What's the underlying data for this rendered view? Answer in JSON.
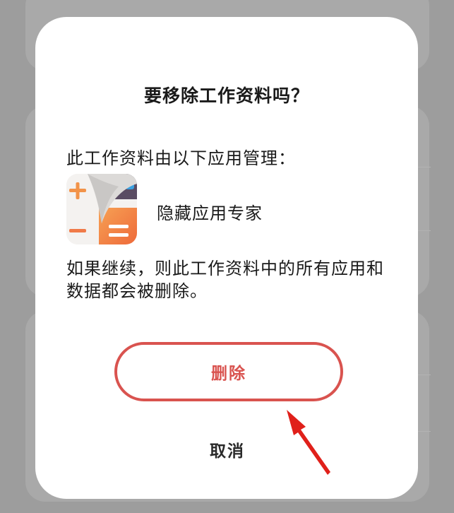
{
  "dialog": {
    "title": "要移除工作资料吗？",
    "subtitle": "此工作资料由以下应用管理：",
    "app": {
      "name": "隐藏应用专家",
      "icon": "calculator-app-icon"
    },
    "warning": "如果继续，则此工作资料中的所有应用和数据都会被删除。",
    "delete_label": "删除",
    "cancel_label": "取消"
  },
  "colors": {
    "accent": "#d9534f",
    "arrow": "#e0201a",
    "overlay": "#9d9d9d"
  }
}
